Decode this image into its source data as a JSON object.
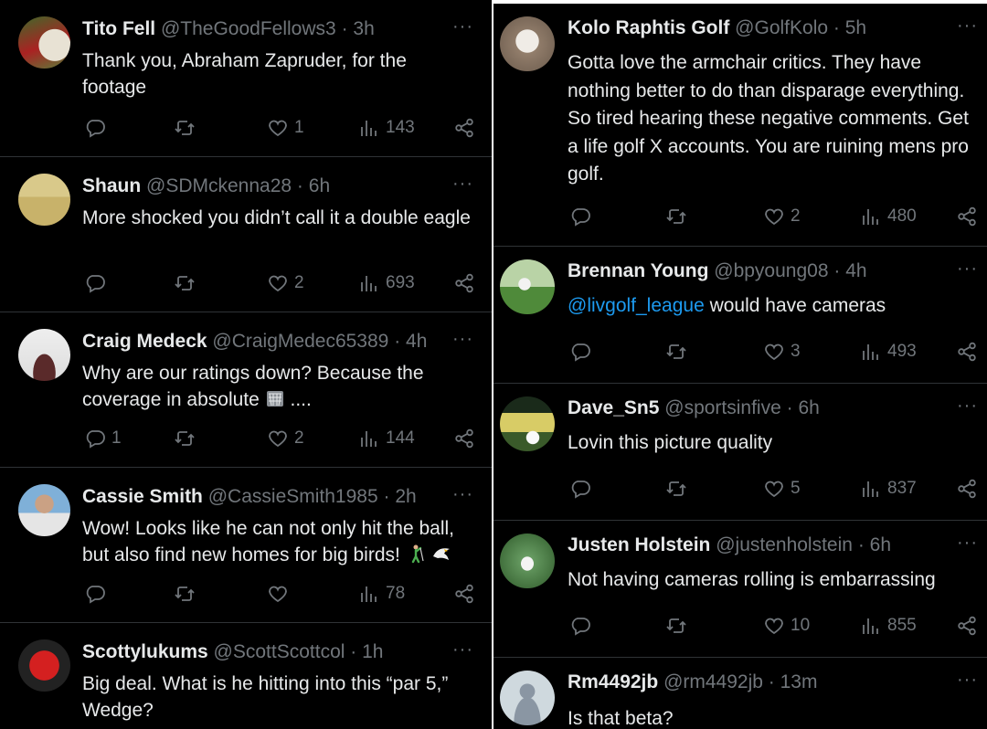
{
  "left_tweets": [
    {
      "name": "Tito Fell",
      "handle": "@TheGoodFellows3",
      "time": "3h",
      "text": "Thank you, Abraham Zapruder, for the footage",
      "replies": "",
      "likes": "1",
      "views": "143"
    },
    {
      "name": "Shaun",
      "handle": "@SDMckenna28",
      "time": "6h",
      "text": "More shocked you didn’t call it a double eagle",
      "replies": "",
      "likes": "2",
      "views": "693"
    },
    {
      "name": "Craig Medeck",
      "handle": "@CraigMedec65389",
      "time": "4h",
      "text": "Why are our ratings down? Because the coverage in absolute",
      "text_after": "....",
      "replies": "1",
      "likes": "2",
      "views": "144"
    },
    {
      "name": "Cassie Smith",
      "handle": "@CassieSmith1985",
      "time": "2h",
      "text": "Wow! Looks like he can not only hit the ball, but also find new homes for big birds!",
      "replies": "",
      "likes": "",
      "views": "78"
    },
    {
      "name": "Scottylukums",
      "handle": "@ScottScottcol",
      "time": "1h",
      "text": "Big deal.  What is he hitting into this “par 5,” Wedge?"
    }
  ],
  "right_tweets": [
    {
      "name": "Kolo Raphtis Golf",
      "handle": "@GolfKolo",
      "time": "5h",
      "text": "Gotta love the armchair critics. They have nothing better to do than disparage everything. So tired hearing these negative comments. Get a life golf X accounts. You are ruining mens pro golf.",
      "replies": "",
      "likes": "2",
      "views": "480"
    },
    {
      "name": "Brennan Young",
      "handle": "@bpyoung08",
      "time": "4h",
      "mention": "@livgolf_league",
      "text": " would have cameras",
      "replies": "",
      "likes": "3",
      "views": "493"
    },
    {
      "name": "Dave_Sn5",
      "handle": "@sportsinfive",
      "time": "6h",
      "text": "Lovin this picture quality",
      "replies": "",
      "likes": "5",
      "views": "837"
    },
    {
      "name": "Justen Holstein",
      "handle": "@justenholstein",
      "time": "6h",
      "text": "Not having cameras rolling is embarrassing",
      "replies": "",
      "likes": "10",
      "views": "855"
    },
    {
      "name": "Rm4492jb",
      "handle": "@rm4492jb",
      "time": "13m",
      "text": "Is that beta?"
    }
  ],
  "ui": {
    "dot": "·",
    "more": "···"
  },
  "colors": {
    "background": "#000000",
    "text": "#e7e9ea",
    "muted": "#71767b",
    "link": "#1d9bf0",
    "divider": "#2f3336"
  }
}
